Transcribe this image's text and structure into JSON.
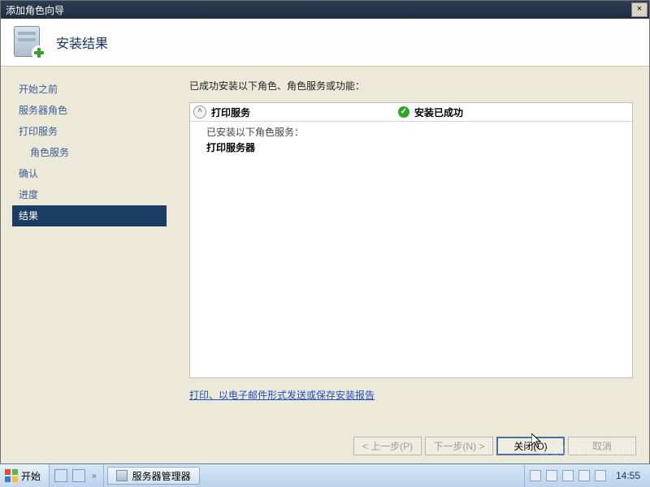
{
  "window": {
    "title": "添加角色向导",
    "close_label": "×"
  },
  "header": {
    "heading": "安装结果"
  },
  "nav": {
    "steps": [
      {
        "label": "开始之前"
      },
      {
        "label": "服务器角色"
      },
      {
        "label": "打印服务"
      },
      {
        "label": "角色服务",
        "sub": true
      },
      {
        "label": "确认"
      },
      {
        "label": "进度"
      },
      {
        "label": "结果",
        "active": true
      }
    ]
  },
  "content": {
    "intro": "已成功安装以下角色、角色服务或功能：",
    "role": {
      "name": "打印服务",
      "status": "安装已成功",
      "services_label": "已安装以下角色服务：",
      "service": "打印服务器"
    },
    "report_link": "打印、以电子邮件形式发送或保存安装报告"
  },
  "buttons": {
    "back": "< 上一步(P)",
    "next": "下一步(N) >",
    "close": "关闭(O)",
    "cancel": "取消"
  },
  "taskbar": {
    "start": "开始",
    "task": "服务器管理器",
    "clock": "14:55"
  },
  "watermark": "51CTO.com"
}
